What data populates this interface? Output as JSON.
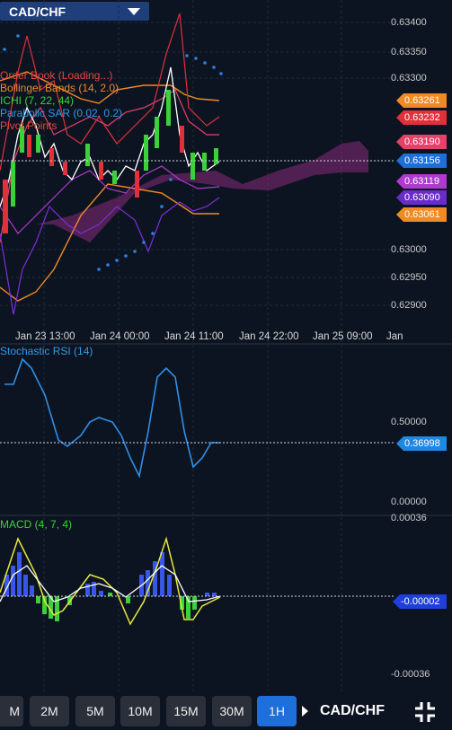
{
  "header": {
    "pair": "CAD/CHF"
  },
  "main_chart": {
    "indicators": [
      {
        "label": "Order Book (Loading...)",
        "color": "#e8453c"
      },
      {
        "label": "Bollinger Bands (14, 2.0)",
        "color": "#f08a24"
      },
      {
        "label": "ICHI (7, 22, 44)",
        "color": "#3ad13a"
      },
      {
        "label": "Parabolic SAR (0.02, 0.2)",
        "color": "#2f7fe0"
      },
      {
        "label": "Pivot Points",
        "color": "#e8453c"
      }
    ],
    "y_axis": [
      "0.63400",
      "0.63350",
      "0.63300",
      "0.63000",
      "0.62950",
      "0.62900"
    ],
    "x_axis": [
      "Jan 23 13:00",
      "Jan 24 00:00",
      "Jan 24 11:00",
      "Jan 24 22:00",
      "Jan 25 09:00",
      "Jan"
    ],
    "price_tags": [
      {
        "value": "0.63261",
        "color": "#f08a24"
      },
      {
        "value": "0.63232",
        "color": "#e0303a"
      },
      {
        "value": "0.63190",
        "color": "#e8406a"
      },
      {
        "value": "0.63156",
        "color": "#1e6fd9"
      },
      {
        "value": "0.63119",
        "color": "#b03ad1"
      },
      {
        "value": "0.63090",
        "color": "#6a2bc9"
      },
      {
        "value": "0.63061",
        "color": "#f08a24"
      }
    ]
  },
  "stoch": {
    "title": "Stochastic RSI (14)",
    "y_axis": [
      "0.50000",
      "0.00000"
    ],
    "tag": "0.36998",
    "tag_color": "#1e88e5"
  },
  "macd": {
    "title": "MACD (4, 7, 4)",
    "y_axis": [
      "0.00036",
      "-0.00036"
    ],
    "tag": "-0.00002",
    "tag_color": "#1e3fd9"
  },
  "toolbar": {
    "timeframes": [
      "M",
      "2M",
      "5M",
      "10M",
      "15M",
      "30M",
      "1H"
    ],
    "active": "1H",
    "pair": "CAD/CHF"
  },
  "icons": {
    "dropdown": "triangle-down-icon",
    "fullscreen": "fullscreen-icon",
    "next": "triangle-right-icon"
  }
}
